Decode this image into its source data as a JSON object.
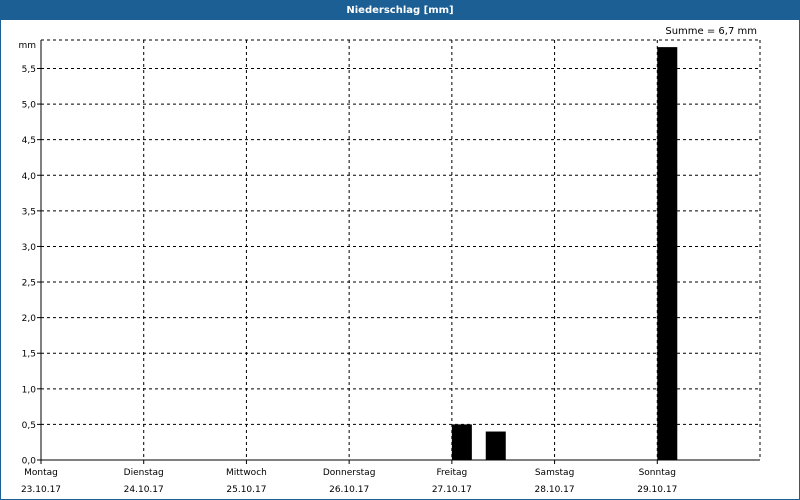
{
  "window": {
    "title": "Niederschlag [mm]"
  },
  "summary": {
    "text": "Summe = 6,7 mm"
  },
  "chart_data": {
    "type": "bar",
    "title": "Niederschlag [mm]",
    "ylabel": "mm",
    "ylim": [
      0,
      5.9
    ],
    "y_ticks": [
      "0,0",
      "0,5",
      "1,0",
      "1,5",
      "2,0",
      "2,5",
      "3,0",
      "3,5",
      "4,0",
      "4,5",
      "5,0",
      "5,5"
    ],
    "x_ticks": [
      {
        "day": "Montag",
        "date": "23.10.17"
      },
      {
        "day": "Dienstag",
        "date": "24.10.17"
      },
      {
        "day": "Mittwoch",
        "date": "25.10.17"
      },
      {
        "day": "Donnerstag",
        "date": "26.10.17"
      },
      {
        "day": "Freitag",
        "date": "27.10.17"
      },
      {
        "day": "Samstag",
        "date": "28.10.17"
      },
      {
        "day": "Sonntag",
        "date": "29.10.17"
      }
    ],
    "bars": [
      {
        "day_offset": 4.0,
        "value": 0.5
      },
      {
        "day_offset": 4.33,
        "value": 0.4
      },
      {
        "day_offset": 6.0,
        "value": 5.8
      }
    ],
    "grid": true,
    "bar_color": "#000000"
  }
}
